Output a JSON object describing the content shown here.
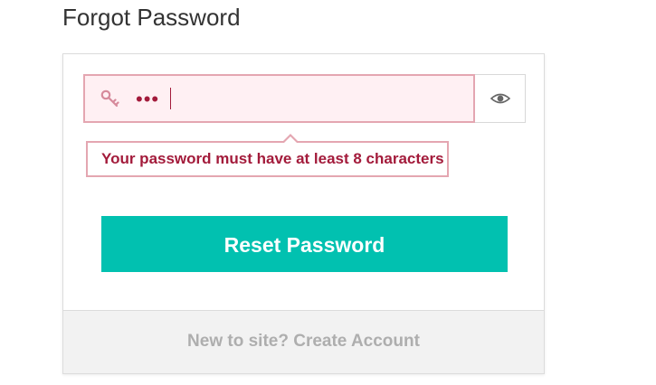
{
  "page": {
    "title": "Forgot Password"
  },
  "password_field": {
    "masked_value": "•••",
    "state": "error",
    "icon": "key-icon"
  },
  "visibility_toggle": {
    "icon": "eye-icon"
  },
  "error": {
    "message": "Your password must have at least 8 characters"
  },
  "actions": {
    "reset_label": "Reset Password"
  },
  "footer": {
    "create_account_text": "New to site? Create Account"
  },
  "colors": {
    "accent": "#01c1b0",
    "error_text": "#a31b3b",
    "error_border": "#e4a6b1",
    "error_bg": "#fff0f3",
    "footer_text": "#aeaeae"
  }
}
